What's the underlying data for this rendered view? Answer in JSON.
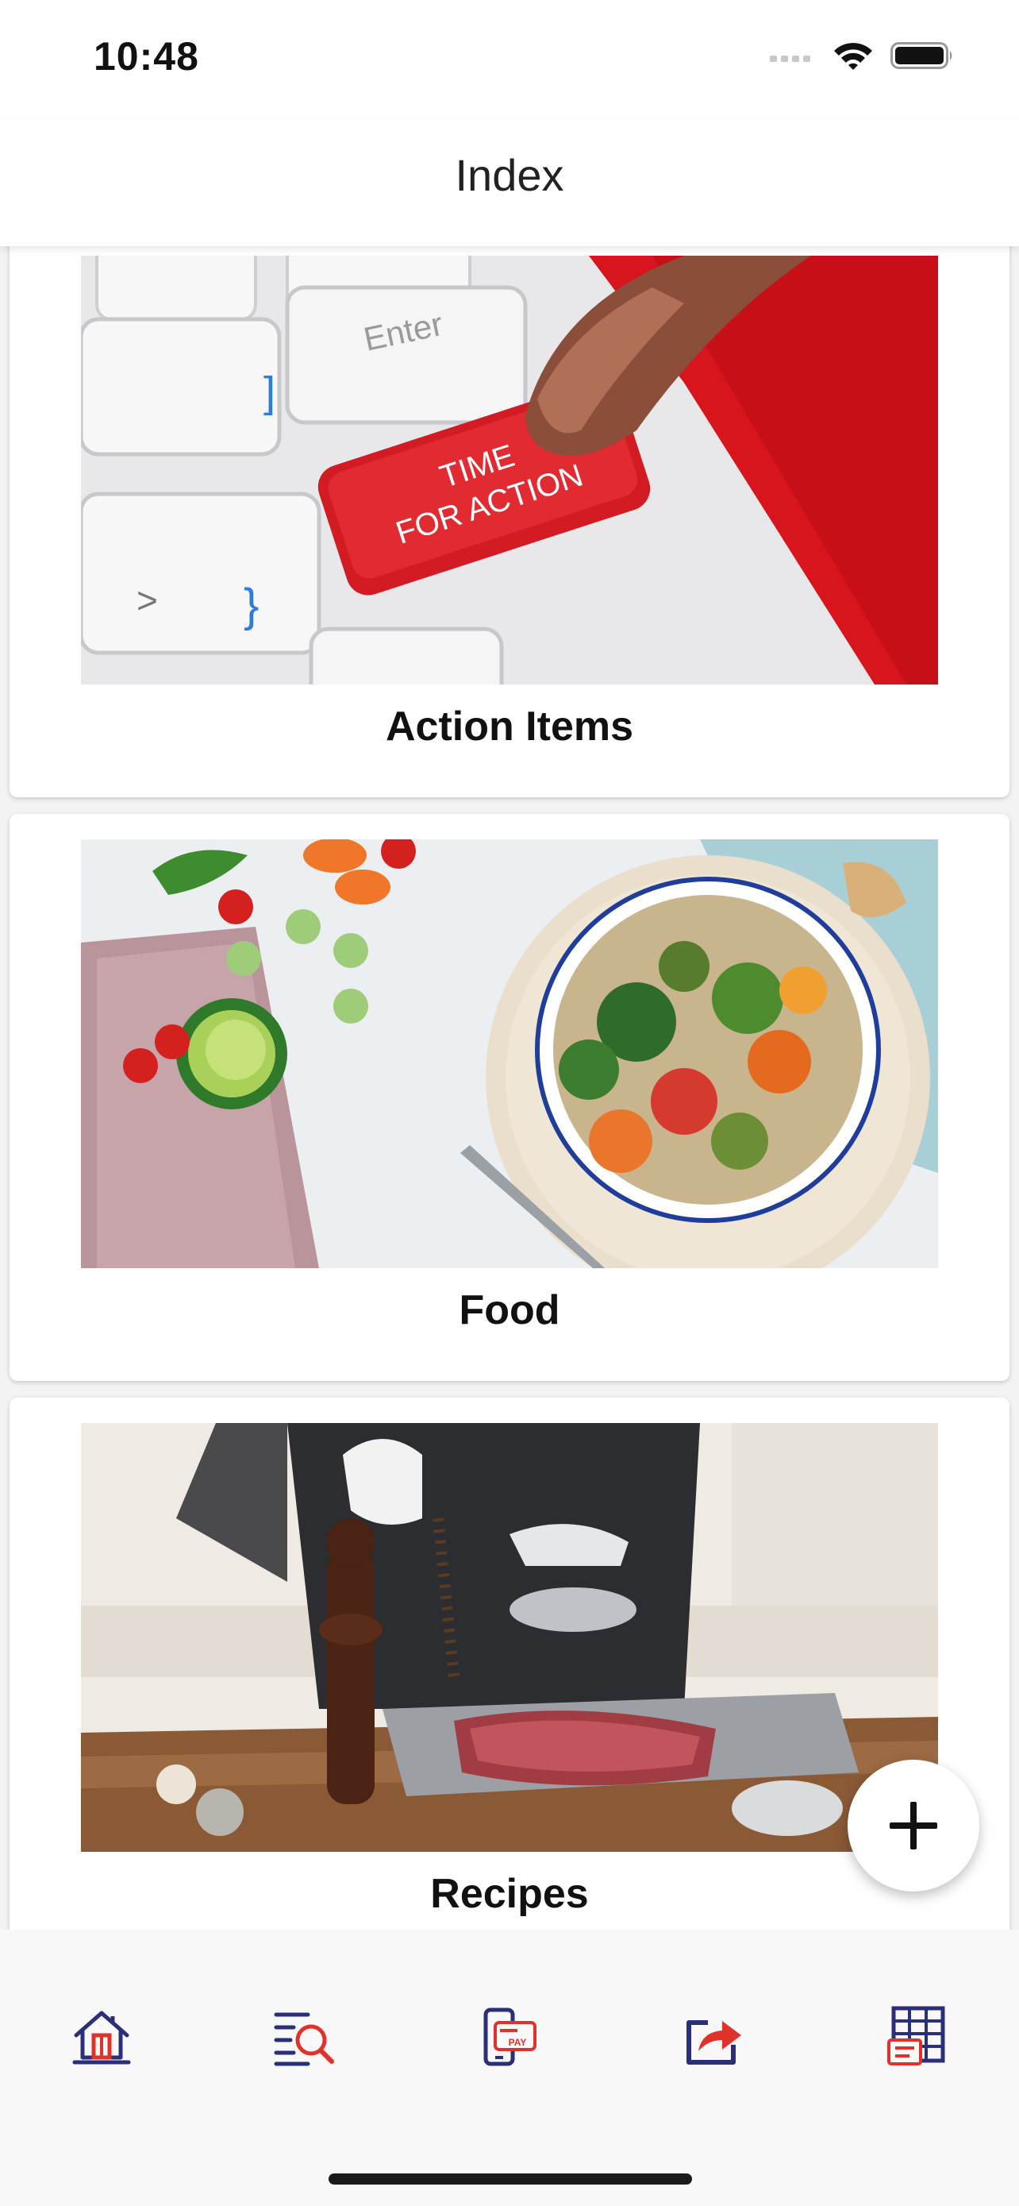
{
  "status_bar": {
    "time": "10:48"
  },
  "nav": {
    "title": "Index"
  },
  "cards": [
    {
      "label": "Action Items",
      "image_icon": "keyboard-time-for-action-photo",
      "image_text_line1": "TIME",
      "image_text_line2": "FOR ACTION",
      "key_label": "Enter"
    },
    {
      "label": "Food",
      "image_icon": "healthy-food-bowl-photo"
    },
    {
      "label": "Recipes",
      "image_icon": "chef-seasoning-meat-photo"
    }
  ],
  "fab": {
    "icon": "plus-icon"
  },
  "tab_bar": {
    "items": [
      {
        "icon": "home-icon"
      },
      {
        "icon": "search-list-icon"
      },
      {
        "icon": "mobile-pay-icon",
        "text": "PAY"
      },
      {
        "icon": "share-icon"
      },
      {
        "icon": "spreadsheet-icon"
      }
    ]
  },
  "colors": {
    "icon_navy": "#2b2f7a",
    "icon_red": "#e0322b",
    "card_red": "#d8141d"
  }
}
